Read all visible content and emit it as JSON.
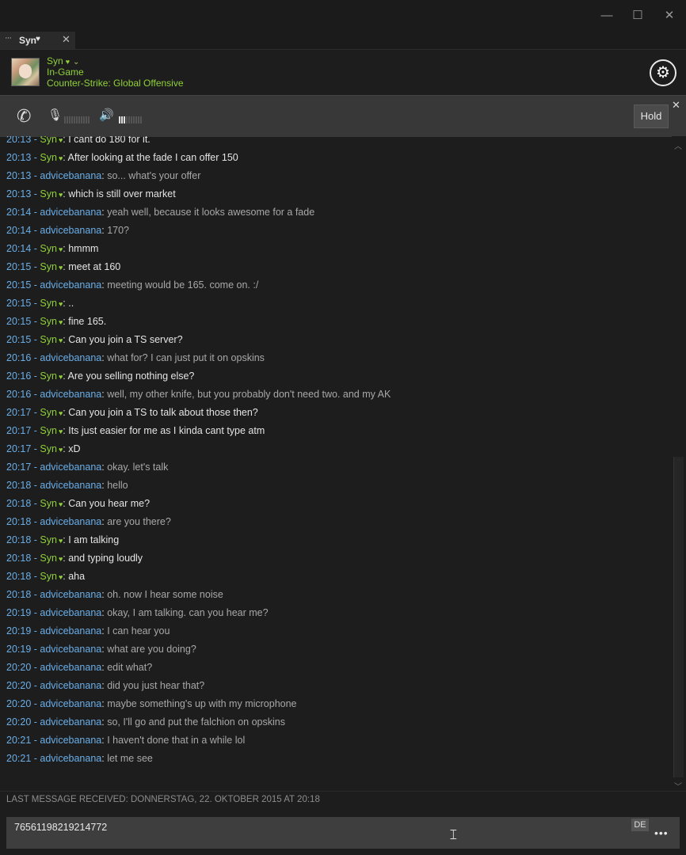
{
  "window": {
    "minimize": "—",
    "maximize": "☐",
    "close": "✕"
  },
  "tab": {
    "dots": "···",
    "label": "Syn",
    "heart": "♥",
    "close": "✕"
  },
  "header": {
    "name": "Syn",
    "heart": "♥",
    "chevron": "⌄",
    "status": "In-Game",
    "game": "Counter-Strike: Global Offensive",
    "settings_icon": "gear-icon"
  },
  "voice": {
    "hold": "Hold",
    "close": "✕",
    "mic_level": 0.0,
    "speaker_level": 0.4
  },
  "colors": {
    "accent_green": "#8fd13a",
    "link_blue": "#6aaee8"
  },
  "messages": [
    {
      "t": "20:13",
      "who": "Syn",
      "text": "I cant do 180 for it."
    },
    {
      "t": "20:13",
      "who": "Syn",
      "text": "After looking at the fade I can offer 150"
    },
    {
      "t": "20:13",
      "who": "advicebanana",
      "text": "so... what's your offer"
    },
    {
      "t": "20:13",
      "who": "Syn",
      "text": "which is still over market"
    },
    {
      "t": "20:14",
      "who": "advicebanana",
      "text": "yeah well, because it looks awesome for a fade"
    },
    {
      "t": "20:14",
      "who": "advicebanana",
      "text": "170?"
    },
    {
      "t": "20:14",
      "who": "Syn",
      "text": "hmmm"
    },
    {
      "t": "20:15",
      "who": "Syn",
      "text": "meet at 160"
    },
    {
      "t": "20:15",
      "who": "advicebanana",
      "text": "meeting would be 165. come on. :/"
    },
    {
      "t": "20:15",
      "who": "Syn",
      "text": ".."
    },
    {
      "t": "20:15",
      "who": "Syn",
      "text": "fine 165."
    },
    {
      "t": "20:15",
      "who": "Syn",
      "text": "Can you join a TS server?"
    },
    {
      "t": "20:16",
      "who": "advicebanana",
      "text": "what for? I can just put it on opskins"
    },
    {
      "t": "20:16",
      "who": "Syn",
      "text": "Are you selling nothing else?"
    },
    {
      "t": "20:16",
      "who": "advicebanana",
      "text": "well, my other knife, but you probably don't need two. and my AK"
    },
    {
      "t": "20:17",
      "who": "Syn",
      "text": "Can you join a TS to talk about those then?"
    },
    {
      "t": "20:17",
      "who": "Syn",
      "text": "Its just easier for me as I kinda cant type atm"
    },
    {
      "t": "20:17",
      "who": "Syn",
      "text": "xD"
    },
    {
      "t": "20:17",
      "who": "advicebanana",
      "text": "okay. let's talk"
    },
    {
      "t": "20:18",
      "who": "advicebanana",
      "text": "hello"
    },
    {
      "t": "20:18",
      "who": "Syn",
      "text": "Can you hear me?"
    },
    {
      "t": "20:18",
      "who": "advicebanana",
      "text": "are you there?"
    },
    {
      "t": "20:18",
      "who": "Syn",
      "text": "I am talking"
    },
    {
      "t": "20:18",
      "who": "Syn",
      "text": "and typing loudly"
    },
    {
      "t": "20:18",
      "who": "Syn",
      "text": "aha"
    },
    {
      "t": "20:18",
      "who": "advicebanana",
      "text": "oh. now I hear some noise"
    },
    {
      "t": "20:19",
      "who": "advicebanana",
      "text": "okay, I am talking. can you hear me?"
    },
    {
      "t": "20:19",
      "who": "advicebanana",
      "text": "I can hear you"
    },
    {
      "t": "20:19",
      "who": "advicebanana",
      "text": "what are you doing?"
    },
    {
      "t": "20:20",
      "who": "advicebanana",
      "text": "edit what?"
    },
    {
      "t": "20:20",
      "who": "advicebanana",
      "text": "did you just hear that?"
    },
    {
      "t": "20:20",
      "who": "advicebanana",
      "text": "maybe something's up with my microphone"
    },
    {
      "t": "20:20",
      "who": "advicebanana",
      "text": "so, I'll go and put the falchion on opskins"
    },
    {
      "t": "20:21",
      "who": "advicebanana",
      "text": "I haven't done that in a while lol"
    },
    {
      "t": "20:21",
      "who": "advicebanana",
      "text": "let me see"
    }
  ],
  "last_message": "LAST MESSAGE RECEIVED: DONNERSTAG, 22. OKTOBER 2015 AT 20:18",
  "input": {
    "value": "76561198219214772",
    "lang": "DE",
    "more": "•••"
  }
}
